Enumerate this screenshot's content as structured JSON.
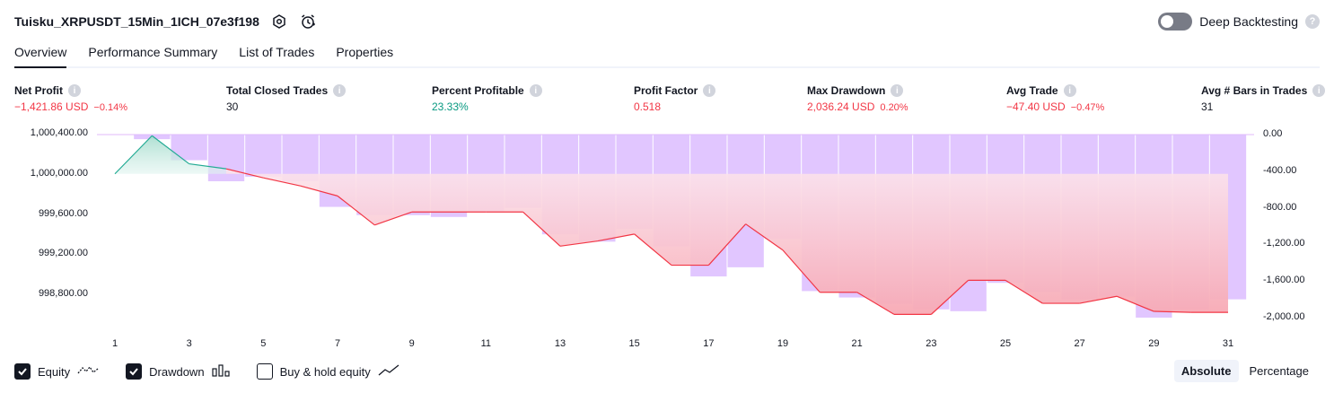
{
  "header": {
    "title": "Tuisku_XRPUSDT_15Min_1ICH_07e3f198",
    "deep_backtesting_label": "Deep Backtesting"
  },
  "tabs": [
    {
      "label": "Overview",
      "active": true
    },
    {
      "label": "Performance Summary",
      "active": false
    },
    {
      "label": "List of Trades",
      "active": false
    },
    {
      "label": "Properties",
      "active": false
    }
  ],
  "stats": {
    "net_profit": {
      "label": "Net Profit",
      "value": "−1,421.86 USD",
      "pct": "−0.14%"
    },
    "total_closed_trades": {
      "label": "Total Closed Trades",
      "value": "30"
    },
    "percent_profitable": {
      "label": "Percent Profitable",
      "value": "23.33%"
    },
    "profit_factor": {
      "label": "Profit Factor",
      "value": "0.518"
    },
    "max_drawdown": {
      "label": "Max Drawdown",
      "value": "2,036.24 USD",
      "pct": "0.20%"
    },
    "avg_trade": {
      "label": "Avg Trade",
      "value": "−47.40 USD",
      "pct": "−0.47%"
    },
    "avg_bars": {
      "label": "Avg # Bars in Trades",
      "value": "31"
    }
  },
  "colors": {
    "negative": "#f23645",
    "positive": "#089981",
    "drawdown_bar": "#dcbcff",
    "equity_loss_line": "#f23645",
    "equity_gain_line": "#22ab94"
  },
  "chart_data": {
    "type": "line",
    "left_axis": {
      "name": "equity",
      "ticks": [
        "1,000,400.00",
        "1,000,000.00",
        "999,600.00",
        "999,200.00",
        "998,800.00"
      ],
      "tick_values": [
        1000400,
        1000000,
        999600,
        999200,
        998800
      ],
      "ylim": [
        998600,
        1000420
      ]
    },
    "right_axis": {
      "name": "drawdown",
      "ticks": [
        "0.00",
        "-400.00",
        "-800.00",
        "-1,200.00",
        "-1,600.00",
        "-2,000.00"
      ],
      "tick_values": [
        0,
        -400,
        -800,
        -1200,
        -1600,
        -2000
      ],
      "ylim": [
        -2000,
        0
      ]
    },
    "x_ticks": [
      "1",
      "3",
      "5",
      "7",
      "9",
      "11",
      "13",
      "15",
      "17",
      "19",
      "21",
      "23",
      "25",
      "27",
      "29",
      "31"
    ],
    "x": [
      1,
      2,
      3,
      4,
      5,
      6,
      7,
      8,
      9,
      10,
      11,
      12,
      13,
      14,
      15,
      16,
      17,
      18,
      19,
      20,
      21,
      22,
      23,
      24,
      25,
      26,
      27,
      28,
      29,
      30,
      31
    ],
    "equity": [
      1000000,
      1000380,
      1000100,
      1000050,
      999960,
      999880,
      999780,
      999490,
      999620,
      999620,
      999620,
      999620,
      999280,
      999330,
      999400,
      999090,
      999090,
      999500,
      999240,
      998820,
      998820,
      998600,
      998600,
      998940,
      998940,
      998710,
      998710,
      998780,
      998630,
      998620,
      998620
    ],
    "drawdown": [
      0,
      -50,
      -280,
      -510,
      -460,
      -510,
      -790,
      -880,
      -880,
      -900,
      -840,
      -800,
      -1090,
      -1170,
      -1030,
      -1220,
      -1550,
      -1450,
      -1140,
      -1710,
      -1780,
      -1850,
      -1910,
      -1930,
      -1620,
      -1720,
      -1800,
      -1770,
      -2000,
      -1910,
      -1800
    ]
  },
  "legend": [
    {
      "label": "Equity",
      "checked": true,
      "icon": "equity-line-icon"
    },
    {
      "label": "Drawdown",
      "checked": true,
      "icon": "drawdown-bars-icon"
    },
    {
      "label": "Buy & hold equity",
      "checked": false,
      "icon": "buy-hold-line-icon"
    }
  ],
  "modes": [
    {
      "label": "Absolute",
      "active": true
    },
    {
      "label": "Percentage",
      "active": false
    }
  ]
}
